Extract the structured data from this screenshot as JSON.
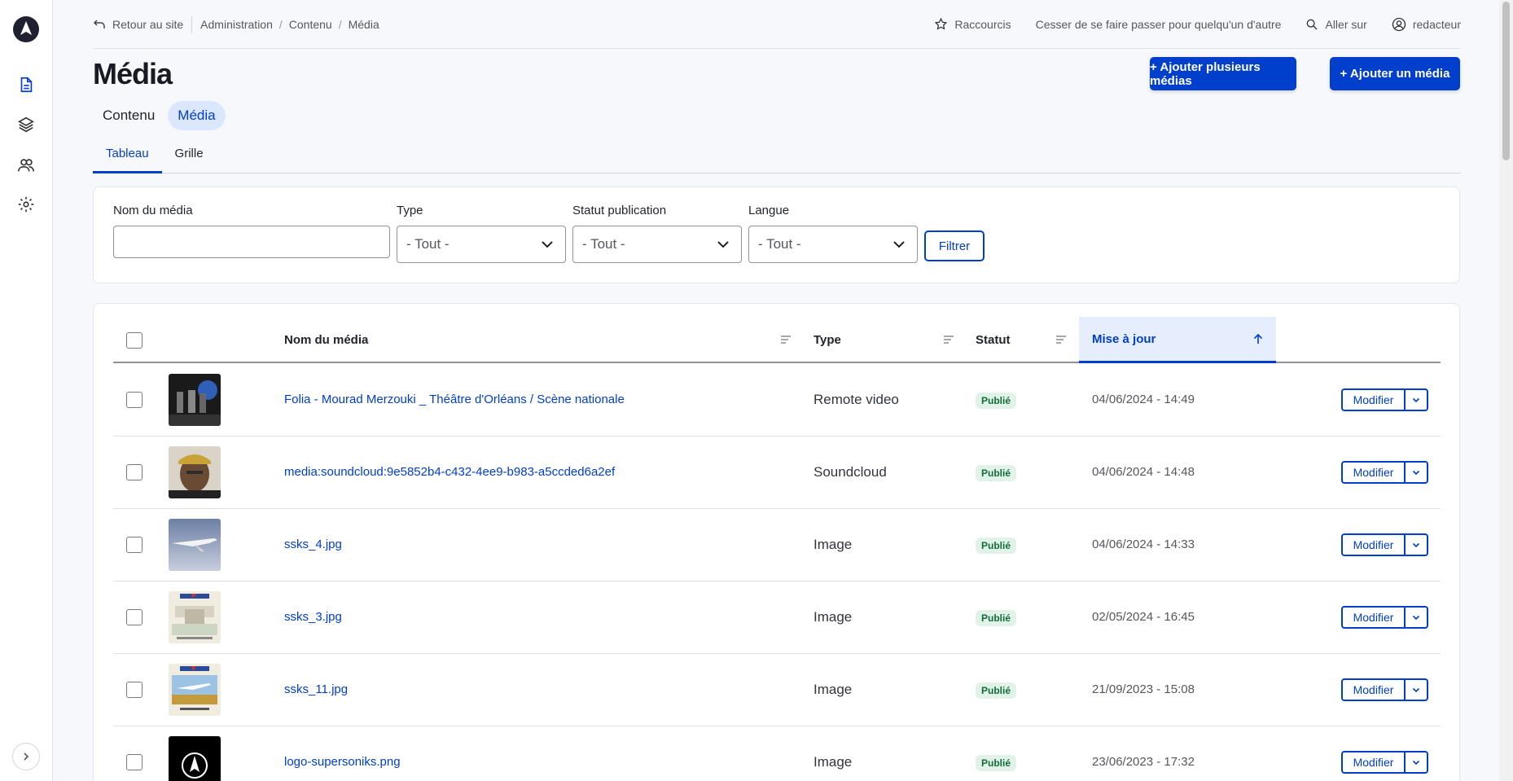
{
  "toolbar": {
    "back_label": "Retour au site",
    "breadcrumb": [
      "Administration",
      "Contenu",
      "Média"
    ],
    "shortcuts_label": "Raccourcis",
    "impersonate_label": "Cesser de se faire passer pour quelqu'un d'autre",
    "goto_label": "Aller sur",
    "user_label": "redacteur"
  },
  "page": {
    "title": "Média",
    "add_multiple_label": "+ Ajouter plusieurs médias",
    "add_one_label": "+ Ajouter un média"
  },
  "primary_tabs": [
    {
      "label": "Contenu",
      "active": false
    },
    {
      "label": "Média",
      "active": true
    }
  ],
  "secondary_tabs": [
    {
      "label": "Tableau",
      "active": true
    },
    {
      "label": "Grille",
      "active": false
    }
  ],
  "filters": {
    "name_label": "Nom du média",
    "name_value": "",
    "type_label": "Type",
    "type_value": "- Tout -",
    "status_label": "Statut publication",
    "status_value": "- Tout -",
    "lang_label": "Langue",
    "lang_value": "- Tout -",
    "submit_label": "Filtrer"
  },
  "table": {
    "headers": {
      "name": "Nom du média",
      "type": "Type",
      "status": "Statut",
      "updated": "Mise à jour"
    },
    "rows": [
      {
        "name": "Folia - Mourad Merzouki _ Théâtre d'Orléans / Scène nationale",
        "type": "Remote video",
        "status": "Publié",
        "updated": "04/06/2024 - 14:49",
        "action": "Modifier"
      },
      {
        "name": "media:soundcloud:9e5852b4-c432-4ee9-b983-a5ccded6a2ef",
        "type": "Soundcloud",
        "status": "Publié",
        "updated": "04/06/2024 - 14:48",
        "action": "Modifier"
      },
      {
        "name": "ssks_4.jpg",
        "type": "Image",
        "status": "Publié",
        "updated": "04/06/2024 - 14:33",
        "action": "Modifier"
      },
      {
        "name": "ssks_3.jpg",
        "type": "Image",
        "status": "Publié",
        "updated": "02/05/2024 - 16:45",
        "action": "Modifier"
      },
      {
        "name": "ssks_11.jpg",
        "type": "Image",
        "status": "Publié",
        "updated": "21/09/2023 - 15:08",
        "action": "Modifier"
      },
      {
        "name": "logo-supersoniks.png",
        "type": "Image",
        "status": "Publié",
        "updated": "23/06/2023 - 17:32",
        "action": "Modifier"
      }
    ]
  },
  "colors": {
    "accent": "#003ecc",
    "badge_bg": "#e1f3e8",
    "badge_text": "#146b3a"
  }
}
